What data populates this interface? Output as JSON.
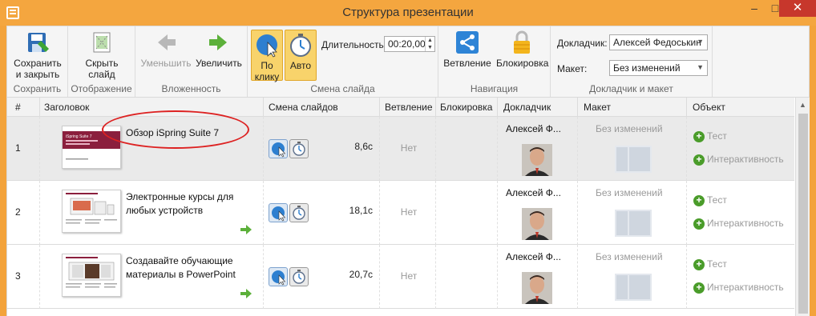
{
  "window": {
    "title": "Структура презентации",
    "minimize": "–",
    "maximize": "□",
    "close": "✕"
  },
  "ribbon": {
    "groups": {
      "save": {
        "label": "Сохранить",
        "button": "Сохранить и закрыть"
      },
      "display": {
        "label": "Отображение",
        "button": "Скрыть слайд"
      },
      "nesting": {
        "label": "Вложенность",
        "decrease": "Уменьшить",
        "increase": "Увеличить"
      },
      "slide_change": {
        "label": "Смена слайда",
        "on_click": "По клику",
        "auto": "Авто",
        "duration_label": "Длительность:",
        "duration_value": "00:20,00"
      },
      "navigation": {
        "label": "Навигация",
        "branching": "Ветвление",
        "lock": "Блокировка"
      },
      "speaker_layout": {
        "label": "Докладчик и макет",
        "speaker_label": "Докладчик:",
        "speaker_value": "Алексей Федоськин",
        "layout_label": "Макет:",
        "layout_value": "Без изменений"
      }
    }
  },
  "grid": {
    "columns": [
      "#",
      "Заголовок",
      "Смена слайдов",
      "Ветвление",
      "Блокировка",
      "Докладчик",
      "Макет",
      "Объект"
    ],
    "rows": [
      {
        "num": "1",
        "title": "Обзор iSpring Suite 7",
        "thumb_heading": "iSpring Suite 7",
        "duration": "8,6с",
        "branching": "Нет",
        "speaker": "Алексей Ф...",
        "layout": "Без изменений",
        "obj_test": "Тест",
        "obj_interactivity": "Интерактивность"
      },
      {
        "num": "2",
        "title": "Электронные курсы для любых устройств",
        "thumb_heading": "",
        "duration": "18,1с",
        "branching": "Нет",
        "speaker": "Алексей Ф...",
        "layout": "Без изменений",
        "obj_test": "Тест",
        "obj_interactivity": "Интерактивность"
      },
      {
        "num": "3",
        "title": "Создавайте обучающие материалы в PowerPoint",
        "thumb_heading": "",
        "duration": "20,7с",
        "branching": "Нет",
        "speaker": "Алексей Ф...",
        "layout": "Без изменений",
        "obj_test": "Тест",
        "obj_interactivity": "Интерактивность"
      }
    ]
  },
  "colors": {
    "titlebar": "#f4a63f",
    "close": "#c7372c",
    "active_button": "#f8d36b",
    "plus": "#4a9c2a",
    "annotation": "#dd2222"
  }
}
